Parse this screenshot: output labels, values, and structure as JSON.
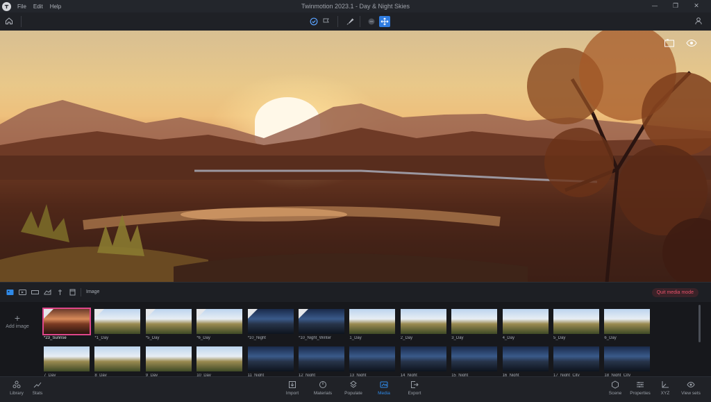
{
  "window": {
    "title": "Twinmotion 2023.1 - Day & Night Skies",
    "menu": [
      "File",
      "Edit",
      "Help"
    ],
    "controls": [
      "—",
      "❐",
      "✕"
    ]
  },
  "media": {
    "section_label": "Image",
    "quit_label": "Quit media mode",
    "add_label": "Add image",
    "thumbnails_row1": [
      {
        "label": "*23_Sunrise",
        "selected": true
      },
      {
        "label": "*1_Day"
      },
      {
        "label": "*5_Day"
      },
      {
        "label": "*6_Day"
      },
      {
        "label": "*10_Night"
      },
      {
        "label": "*10_Night_Winter"
      },
      {
        "label": "1_Day"
      },
      {
        "label": "2_Day"
      },
      {
        "label": "3_Day"
      },
      {
        "label": "4_Day"
      },
      {
        "label": "5_Day"
      },
      {
        "label": "6_Day"
      }
    ],
    "thumbnails_row2": [
      {
        "label": "7_Day"
      },
      {
        "label": "8_Day"
      },
      {
        "label": "9_Day"
      },
      {
        "label": "10_Day"
      },
      {
        "label": "11_Night"
      },
      {
        "label": "12_Night"
      },
      {
        "label": "13_Night"
      },
      {
        "label": "14_Night"
      },
      {
        "label": "15_Night"
      },
      {
        "label": "16_Night"
      },
      {
        "label": "17_Night_City"
      },
      {
        "label": "18_Night_City"
      }
    ]
  },
  "bottombar": {
    "left": [
      {
        "label": "Library",
        "icon": "library-icon"
      },
      {
        "label": "Stats",
        "icon": "stats-icon"
      }
    ],
    "center": [
      {
        "label": "Import",
        "icon": "import-icon"
      },
      {
        "label": "Materials",
        "icon": "materials-icon"
      },
      {
        "label": "Populate",
        "icon": "populate-icon"
      },
      {
        "label": "Media",
        "icon": "media-icon",
        "active": true
      },
      {
        "label": "Export",
        "icon": "export-icon"
      }
    ],
    "right": [
      {
        "label": "Scene",
        "icon": "scene-icon"
      },
      {
        "label": "Properties",
        "icon": "properties-icon"
      },
      {
        "label": "XYZ",
        "icon": "xyz-icon"
      },
      {
        "label": "View sets",
        "icon": "view-sets-icon"
      }
    ]
  },
  "colors": {
    "accent": "#2f7ce0",
    "selection": "#e0468a",
    "quit": "#e7526a"
  }
}
